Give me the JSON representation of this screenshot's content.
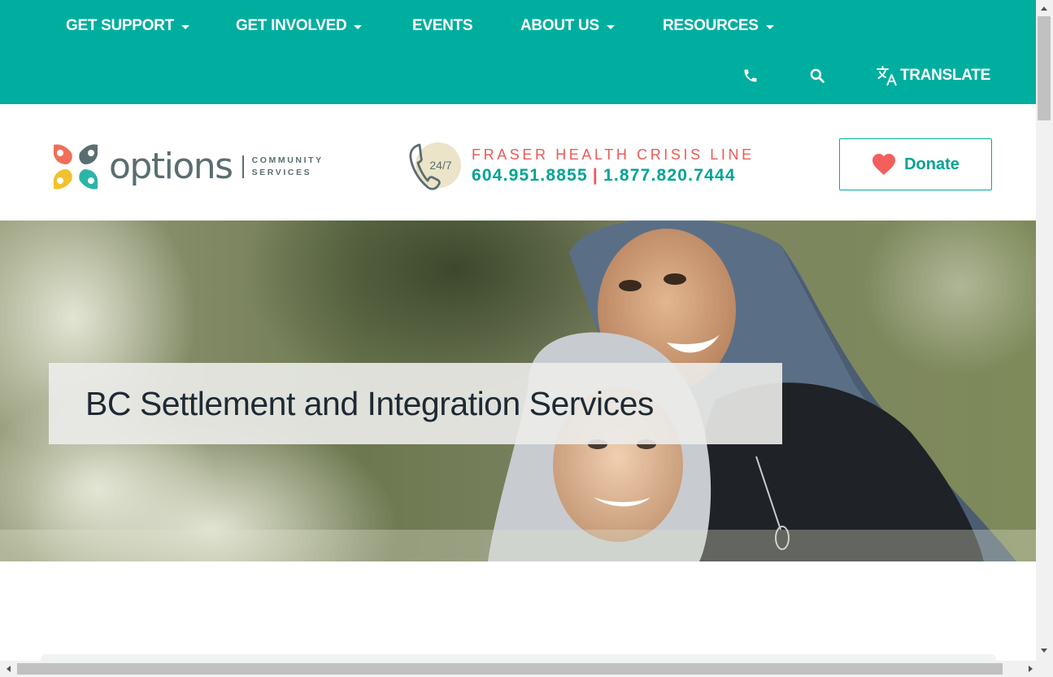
{
  "nav": {
    "items": [
      {
        "label": "GET SUPPORT",
        "dropdown": true
      },
      {
        "label": "GET INVOLVED",
        "dropdown": true
      },
      {
        "label": "EVENTS",
        "dropdown": false
      },
      {
        "label": "ABOUT US",
        "dropdown": true
      },
      {
        "label": "RESOURCES",
        "dropdown": true
      }
    ],
    "utility": {
      "phone_icon": "phone-icon",
      "search_icon": "search-icon",
      "translate_icon": "translate-icon",
      "translate_label": "TRANSLATE"
    }
  },
  "header": {
    "logo": {
      "wordmark": "options",
      "sub_line1": "COMMUNITY",
      "sub_line2": "SERVICES"
    },
    "crisis": {
      "badge": "24/7",
      "title": "FRASER HEALTH CRISIS LINE",
      "phone1": "604.951.8855",
      "separator": "|",
      "phone2": "1.877.820.7444"
    },
    "donate": {
      "label": "Donate",
      "icon": "heart-icon"
    }
  },
  "hero": {
    "title": "BC Settlement and Integration Services"
  },
  "colors": {
    "teal": "#00ae9f",
    "teal_text": "#00a394",
    "coral": "#ea5a57",
    "logo_grey": "#5a6e70"
  }
}
